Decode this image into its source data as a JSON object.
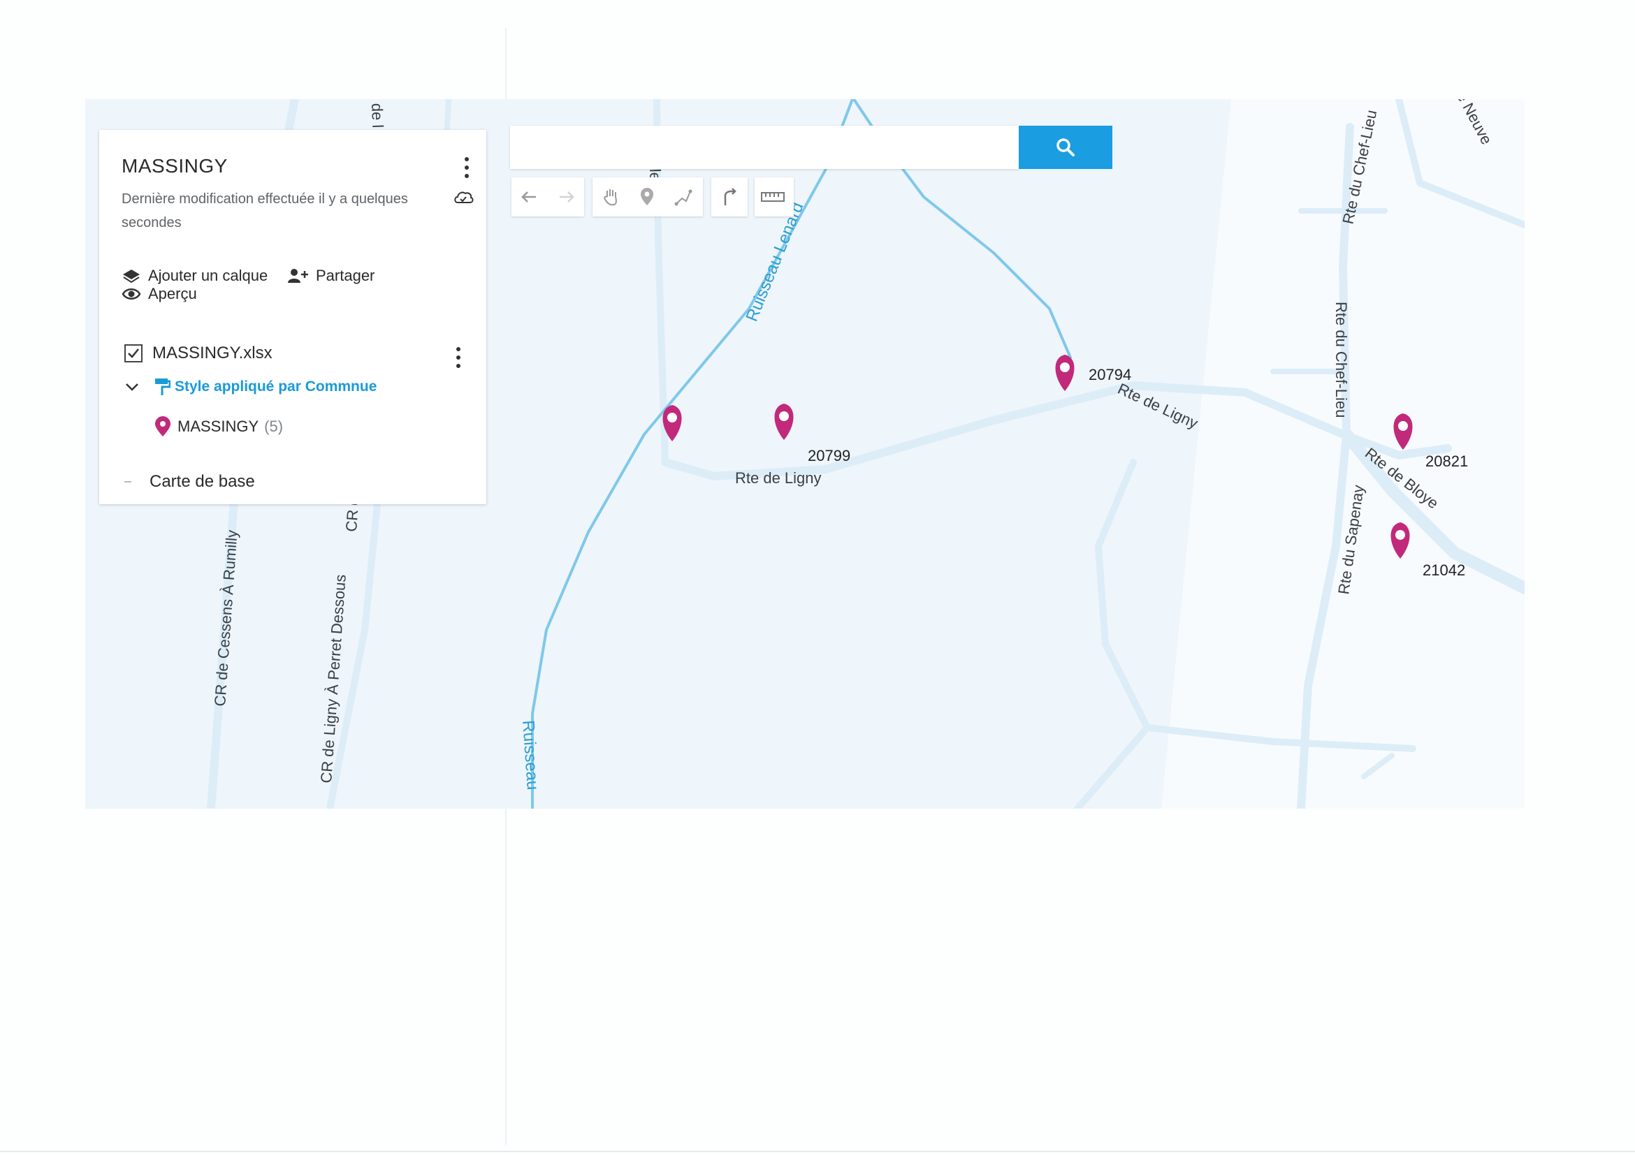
{
  "panel": {
    "title": "MASSINGY",
    "subtitle": "Dernière modification effectuée il y a quelques secondes",
    "actions": {
      "add_layer": "Ajouter un calque",
      "share": "Partager",
      "preview": "Aperçu"
    },
    "layer": {
      "name": "MASSINGY.xlsx",
      "checked": true,
      "style_label": "Style appliqué par Commnue",
      "category_name": "MASSINGY",
      "category_count": "(5)"
    },
    "base_map": "Carte de base"
  },
  "search": {
    "value": "",
    "button_icon": "search-icon"
  },
  "toolbar": {
    "tools": [
      "undo-icon",
      "redo-icon",
      "hand-icon",
      "marker-icon",
      "draw-line-icon",
      "route-icon",
      "ruler-icon"
    ]
  },
  "map": {
    "colors": {
      "road": "#dcedf8",
      "water": "#7fc8ea",
      "marker": "#c2297a",
      "background": "#eef5fb"
    },
    "road_labels": {
      "cr_cessens": "CR de Cessens À Rumilly",
      "cr_ligny_perret": "CR de Ligny À Perret Dessous",
      "cr_top": "CR d",
      "de_top": "de l",
      "ly_top": "le ... y",
      "rte_ligny_1": "Rte de Ligny",
      "rte_ligny_2": "Rte de Ligny",
      "rte_chef_lieu_1": "Rte du Chef-Lieu",
      "rte_chef_lieu_2": "Rte du Chef-Lieu",
      "rte_sapenay": "Rte du Sapenay",
      "rte_bloye": "Rte de Bloye",
      "neuve": "le Neuve"
    },
    "water_labels": {
      "ruisseau_lenard": "Ruisseau Lenard",
      "ruisseau_bottom": "Ruisseau"
    },
    "markers": [
      {
        "id": "",
        "label": ""
      },
      {
        "id": "20799",
        "label": "20799"
      },
      {
        "id": "20794",
        "label": "20794"
      },
      {
        "id": "20821",
        "label": "20821"
      },
      {
        "id": "21042",
        "label": "21042"
      }
    ]
  }
}
